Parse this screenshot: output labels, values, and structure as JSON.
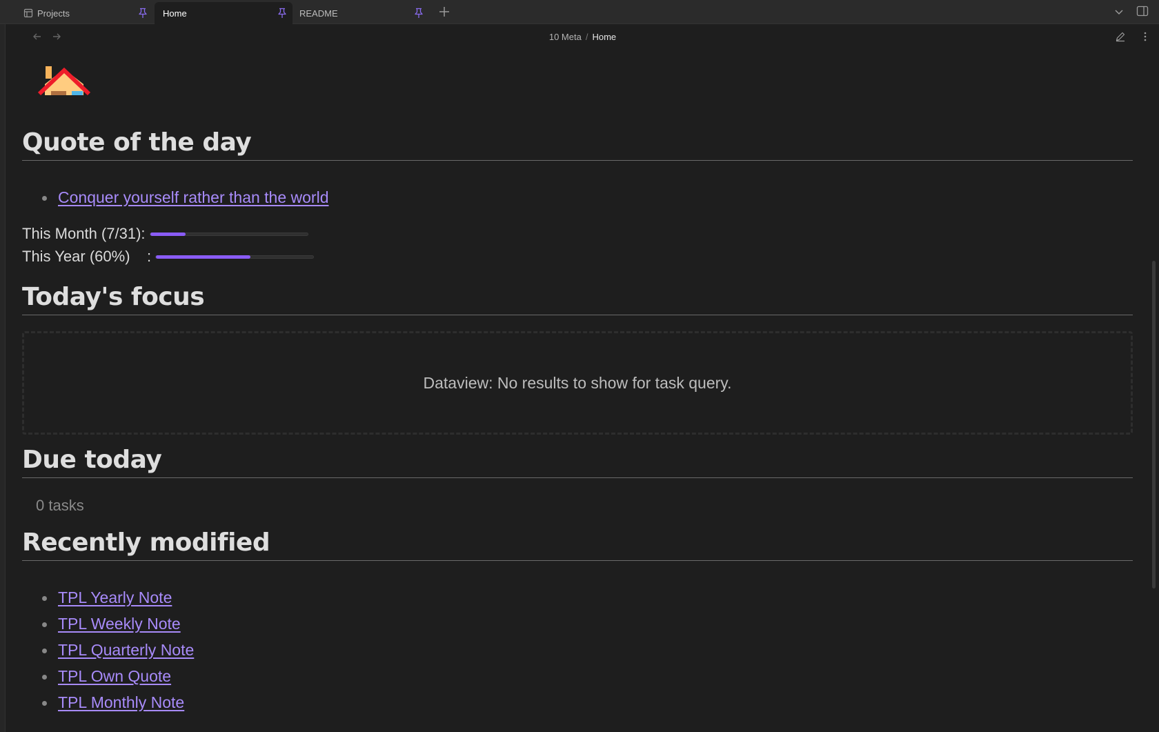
{
  "tabs": [
    {
      "label": "Projects",
      "active": false,
      "pinned": true
    },
    {
      "label": "Home",
      "active": true,
      "pinned": true
    },
    {
      "label": "README",
      "active": false,
      "pinned": true
    }
  ],
  "breadcrumb": {
    "parent": "10 Meta",
    "separator": "/",
    "current": "Home"
  },
  "sections": {
    "quote": {
      "heading": "Quote of the day",
      "link": "Conquer yourself rather than the world"
    },
    "progress": {
      "month": {
        "label": "This Month (7/31):",
        "fraction": 0.226
      },
      "year": {
        "label": "This Year (60%)    :",
        "fraction": 0.6
      }
    },
    "focus": {
      "heading": "Today's focus",
      "empty_message": "Dataview: No results to show for task query."
    },
    "due": {
      "heading": "Due today",
      "count_text": "0 tasks"
    },
    "recent": {
      "heading": "Recently modified",
      "items": [
        "TPL Yearly Note",
        "TPL Weekly Note",
        "TPL Quarterly Note",
        "TPL Own Quote",
        "TPL Monthly Note"
      ]
    }
  },
  "colors": {
    "accent": "#8a5cf6",
    "link": "#a88bfa",
    "background": "#1e1e1e",
    "tabbar": "#2b2b2b"
  },
  "icons": {
    "header_emoji": "house-icon",
    "tab_projects": "table-icon",
    "pin": "pin-icon",
    "new_tab": "plus-icon",
    "dropdown": "chevron-down-icon",
    "sidebar": "sidebar-toggle-icon",
    "back": "arrow-left-icon",
    "forward": "arrow-right-icon",
    "edit": "pencil-icon",
    "more": "more-vertical-icon"
  }
}
